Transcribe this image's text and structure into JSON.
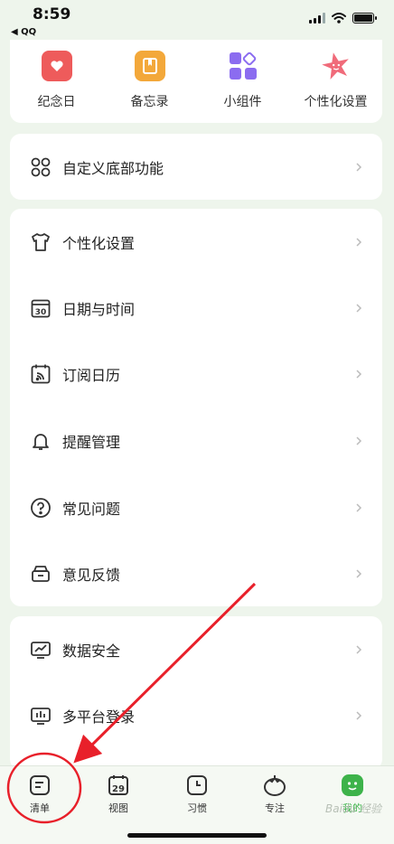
{
  "status_bar": {
    "time": "8:59",
    "back_app": "◀ QQ"
  },
  "shortcuts": [
    {
      "label": "纪念日",
      "icon": "calendar-heart-icon",
      "color": "#ee5b5b"
    },
    {
      "label": "备忘录",
      "icon": "bookmark-note-icon",
      "color": "#f3a83a"
    },
    {
      "label": "小组件",
      "icon": "widgets-icon",
      "color": "#8b6cf0"
    },
    {
      "label": "个性化设置",
      "icon": "star-face-icon",
      "color": "#f06b7a"
    }
  ],
  "menu_group_1": [
    {
      "label": "自定义底部功能",
      "icon": "four-circles-icon"
    }
  ],
  "menu_group_2": [
    {
      "label": "个性化设置",
      "icon": "tshirt-icon"
    },
    {
      "label": "日期与时间",
      "icon": "calendar-30-icon"
    },
    {
      "label": "订阅日历",
      "icon": "calendar-rss-icon"
    },
    {
      "label": "提醒管理",
      "icon": "bell-icon"
    },
    {
      "label": "常见问题",
      "icon": "question-icon"
    },
    {
      "label": "意见反馈",
      "icon": "feedback-box-icon"
    }
  ],
  "menu_group_3": [
    {
      "label": "数据安全",
      "icon": "chart-monitor-icon"
    },
    {
      "label": "多平台登录",
      "icon": "multi-platform-icon"
    }
  ],
  "tabbar": [
    {
      "label": "清单",
      "icon": "list-icon",
      "active": false
    },
    {
      "label": "视图",
      "icon": "calendar-29-icon",
      "icon_text": "29",
      "active": false
    },
    {
      "label": "习惯",
      "icon": "clock-icon",
      "active": false
    },
    {
      "label": "专注",
      "icon": "tomato-icon",
      "active": false
    },
    {
      "label": "我的",
      "icon": "avatar-face-icon",
      "active": true
    }
  ],
  "colors": {
    "accent": "#3db34a",
    "annotation": "#e8202a",
    "background": "#eef5ec"
  },
  "watermark": "Baidu 经验"
}
